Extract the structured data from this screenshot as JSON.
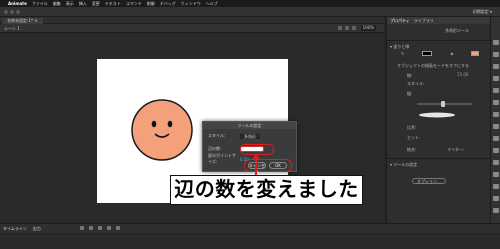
{
  "menubar": {
    "app_name": "Animate",
    "items": [
      "ファイル",
      "編集",
      "表示",
      "挿入",
      "変更",
      "テキスト",
      "コマンド",
      "制御",
      "デバッグ",
      "ウィンドウ",
      "ヘルプ"
    ]
  },
  "workspace_label": "初期設定 ▾",
  "document_tab": "名称未設定-1* ✕",
  "scene_label": "シーン 1",
  "zoom_value": "100%",
  "dialog": {
    "title": "ツールの設定",
    "style_label": "スタイル:",
    "style_value": "多角形",
    "sides_label": "辺の数:",
    "star_label": "星のポイントサイズ:",
    "star_value": "0.50",
    "cancel_label": "キャンセル",
    "ok_label": "OK"
  },
  "annotation_text": "辺の数を変えました",
  "properties": {
    "tab_properties": "プロパティ",
    "tab_library": "ライブラリ",
    "tool_name": "多角形ツール",
    "section_fill_stroke": "▾ 塗りと線",
    "object_drawing_label": "オブジェクトの描画モードをオフにする",
    "stroke_label": "線:",
    "stroke_value": "15.00",
    "style_label": "スタイル:",
    "width_label": "幅:",
    "scale_label": "比率:",
    "cap_label": "ヒント",
    "join_label": "結合:",
    "miter_label": "マイター:",
    "section_tool_settings": "▾ ツールの設定",
    "options_button": "オプション..."
  },
  "timeline": {
    "tab_timeline": "タイムライン",
    "tab_output": "出力"
  },
  "colors": {
    "face_fill": "#f4a07a",
    "face_stroke": "#1a1a1a",
    "highlight": "#d82020"
  }
}
